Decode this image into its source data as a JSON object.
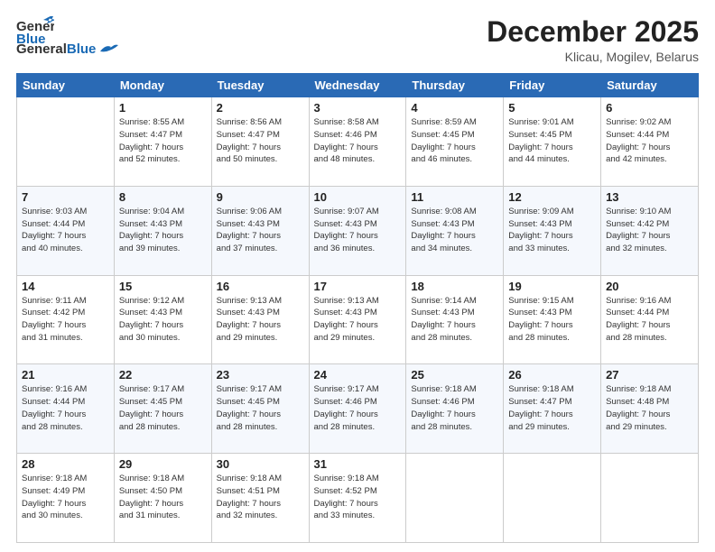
{
  "header": {
    "logo_general": "General",
    "logo_blue": "Blue",
    "month": "December 2025",
    "location": "Klicau, Mogilev, Belarus"
  },
  "days_of_week": [
    "Sunday",
    "Monday",
    "Tuesday",
    "Wednesday",
    "Thursday",
    "Friday",
    "Saturday"
  ],
  "weeks": [
    [
      {
        "day": "",
        "sunrise": "",
        "sunset": "",
        "daylight": ""
      },
      {
        "day": "1",
        "sunrise": "Sunrise: 8:55 AM",
        "sunset": "Sunset: 4:47 PM",
        "daylight": "Daylight: 7 hours and 52 minutes."
      },
      {
        "day": "2",
        "sunrise": "Sunrise: 8:56 AM",
        "sunset": "Sunset: 4:47 PM",
        "daylight": "Daylight: 7 hours and 50 minutes."
      },
      {
        "day": "3",
        "sunrise": "Sunrise: 8:58 AM",
        "sunset": "Sunset: 4:46 PM",
        "daylight": "Daylight: 7 hours and 48 minutes."
      },
      {
        "day": "4",
        "sunrise": "Sunrise: 8:59 AM",
        "sunset": "Sunset: 4:45 PM",
        "daylight": "Daylight: 7 hours and 46 minutes."
      },
      {
        "day": "5",
        "sunrise": "Sunrise: 9:01 AM",
        "sunset": "Sunset: 4:45 PM",
        "daylight": "Daylight: 7 hours and 44 minutes."
      },
      {
        "day": "6",
        "sunrise": "Sunrise: 9:02 AM",
        "sunset": "Sunset: 4:44 PM",
        "daylight": "Daylight: 7 hours and 42 minutes."
      }
    ],
    [
      {
        "day": "7",
        "sunrise": "Sunrise: 9:03 AM",
        "sunset": "Sunset: 4:44 PM",
        "daylight": "Daylight: 7 hours and 40 minutes."
      },
      {
        "day": "8",
        "sunrise": "Sunrise: 9:04 AM",
        "sunset": "Sunset: 4:43 PM",
        "daylight": "Daylight: 7 hours and 39 minutes."
      },
      {
        "day": "9",
        "sunrise": "Sunrise: 9:06 AM",
        "sunset": "Sunset: 4:43 PM",
        "daylight": "Daylight: 7 hours and 37 minutes."
      },
      {
        "day": "10",
        "sunrise": "Sunrise: 9:07 AM",
        "sunset": "Sunset: 4:43 PM",
        "daylight": "Daylight: 7 hours and 36 minutes."
      },
      {
        "day": "11",
        "sunrise": "Sunrise: 9:08 AM",
        "sunset": "Sunset: 4:43 PM",
        "daylight": "Daylight: 7 hours and 34 minutes."
      },
      {
        "day": "12",
        "sunrise": "Sunrise: 9:09 AM",
        "sunset": "Sunset: 4:43 PM",
        "daylight": "Daylight: 7 hours and 33 minutes."
      },
      {
        "day": "13",
        "sunrise": "Sunrise: 9:10 AM",
        "sunset": "Sunset: 4:42 PM",
        "daylight": "Daylight: 7 hours and 32 minutes."
      }
    ],
    [
      {
        "day": "14",
        "sunrise": "Sunrise: 9:11 AM",
        "sunset": "Sunset: 4:42 PM",
        "daylight": "Daylight: 7 hours and 31 minutes."
      },
      {
        "day": "15",
        "sunrise": "Sunrise: 9:12 AM",
        "sunset": "Sunset: 4:43 PM",
        "daylight": "Daylight: 7 hours and 30 minutes."
      },
      {
        "day": "16",
        "sunrise": "Sunrise: 9:13 AM",
        "sunset": "Sunset: 4:43 PM",
        "daylight": "Daylight: 7 hours and 29 minutes."
      },
      {
        "day": "17",
        "sunrise": "Sunrise: 9:13 AM",
        "sunset": "Sunset: 4:43 PM",
        "daylight": "Daylight: 7 hours and 29 minutes."
      },
      {
        "day": "18",
        "sunrise": "Sunrise: 9:14 AM",
        "sunset": "Sunset: 4:43 PM",
        "daylight": "Daylight: 7 hours and 28 minutes."
      },
      {
        "day": "19",
        "sunrise": "Sunrise: 9:15 AM",
        "sunset": "Sunset: 4:43 PM",
        "daylight": "Daylight: 7 hours and 28 minutes."
      },
      {
        "day": "20",
        "sunrise": "Sunrise: 9:16 AM",
        "sunset": "Sunset: 4:44 PM",
        "daylight": "Daylight: 7 hours and 28 minutes."
      }
    ],
    [
      {
        "day": "21",
        "sunrise": "Sunrise: 9:16 AM",
        "sunset": "Sunset: 4:44 PM",
        "daylight": "Daylight: 7 hours and 28 minutes."
      },
      {
        "day": "22",
        "sunrise": "Sunrise: 9:17 AM",
        "sunset": "Sunset: 4:45 PM",
        "daylight": "Daylight: 7 hours and 28 minutes."
      },
      {
        "day": "23",
        "sunrise": "Sunrise: 9:17 AM",
        "sunset": "Sunset: 4:45 PM",
        "daylight": "Daylight: 7 hours and 28 minutes."
      },
      {
        "day": "24",
        "sunrise": "Sunrise: 9:17 AM",
        "sunset": "Sunset: 4:46 PM",
        "daylight": "Daylight: 7 hours and 28 minutes."
      },
      {
        "day": "25",
        "sunrise": "Sunrise: 9:18 AM",
        "sunset": "Sunset: 4:46 PM",
        "daylight": "Daylight: 7 hours and 28 minutes."
      },
      {
        "day": "26",
        "sunrise": "Sunrise: 9:18 AM",
        "sunset": "Sunset: 4:47 PM",
        "daylight": "Daylight: 7 hours and 29 minutes."
      },
      {
        "day": "27",
        "sunrise": "Sunrise: 9:18 AM",
        "sunset": "Sunset: 4:48 PM",
        "daylight": "Daylight: 7 hours and 29 minutes."
      }
    ],
    [
      {
        "day": "28",
        "sunrise": "Sunrise: 9:18 AM",
        "sunset": "Sunset: 4:49 PM",
        "daylight": "Daylight: 7 hours and 30 minutes."
      },
      {
        "day": "29",
        "sunrise": "Sunrise: 9:18 AM",
        "sunset": "Sunset: 4:50 PM",
        "daylight": "Daylight: 7 hours and 31 minutes."
      },
      {
        "day": "30",
        "sunrise": "Sunrise: 9:18 AM",
        "sunset": "Sunset: 4:51 PM",
        "daylight": "Daylight: 7 hours and 32 minutes."
      },
      {
        "day": "31",
        "sunrise": "Sunrise: 9:18 AM",
        "sunset": "Sunset: 4:52 PM",
        "daylight": "Daylight: 7 hours and 33 minutes."
      },
      {
        "day": "",
        "sunrise": "",
        "sunset": "",
        "daylight": ""
      },
      {
        "day": "",
        "sunrise": "",
        "sunset": "",
        "daylight": ""
      },
      {
        "day": "",
        "sunrise": "",
        "sunset": "",
        "daylight": ""
      }
    ]
  ]
}
